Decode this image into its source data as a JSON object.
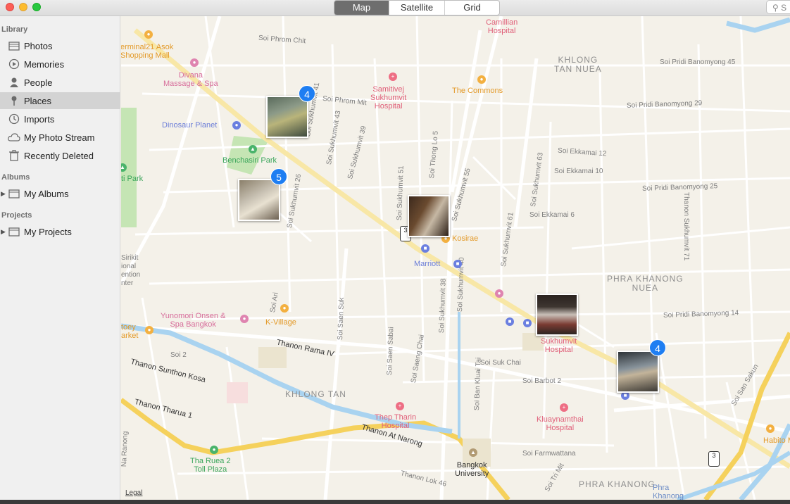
{
  "window": {
    "segments": [
      "Map",
      "Satellite",
      "Grid"
    ],
    "search_text": "S"
  },
  "sidebar": {
    "sections": {
      "library": "Library",
      "albums": "Albums",
      "projects": "Projects"
    },
    "library_items": [
      {
        "label": "Photos",
        "icon": "photos-icon"
      },
      {
        "label": "Memories",
        "icon": "memories-icon"
      },
      {
        "label": "People",
        "icon": "people-icon"
      },
      {
        "label": "Places",
        "icon": "places-pin-icon",
        "selected": true
      },
      {
        "label": "Imports",
        "icon": "imports-clock-icon"
      },
      {
        "label": "My Photo Stream",
        "icon": "cloud-icon"
      },
      {
        "label": "Recently Deleted",
        "icon": "trash-icon"
      }
    ],
    "albums_item": "My Albums",
    "projects_item": "My Projects"
  },
  "map": {
    "labels": {
      "terminal21": "erminal21 Asok\nShopping Mall",
      "soi_phrom_chit": "Soi Phrom Chit",
      "camillian": "Camillian\nHospital",
      "khlong_tan_nuea": "KHLONG\nTAN NUEA",
      "soi_pridi_45": "Soi Pridi Banomyong 45",
      "divana": "Divana\nMassage & Spa",
      "samitivej": "Samitivej\nSukhumvit\nHospital",
      "the_commons": "The Commons",
      "soi_phrom_mit": "Soi Phrom Mit",
      "soi_pridi_banomyong": "Soi Pridi Banomyong 29",
      "dinosaur_planet": "Dinosaur Planet",
      "soi_sukhumvit_41": "Soi Sukhumvit 41",
      "soi_sukhumvit_43": "Soi Sukhumvit 43",
      "soi_sukhumvit_39": "Soi Sukhumvit 39",
      "soi_thong_lo_5": "Soi Thong Lo 5",
      "soi_sukhumvit_55": "Soi Sukhumvit 55",
      "soi_sukhumvit_63": "Soi Sukhumvit 63",
      "soi_ekkamai_12": "Soi Ekkamai 12",
      "soi_ekkamai_10": "Soi Ekkamai 10",
      "soi_pridi_banomyong_25": "Soi Pridi Banomyong 25",
      "benchasiri": "Benchasiri Park",
      "ti_park": "ti Park",
      "soi_sukhumvit_26": "Soi Sukhumvit 26",
      "soi_sukhumvit_51": "Soi Sukhumvit 51",
      "soi_ekkamai_6": "Soi Ekkamai 6",
      "thanon_sukhumvit_71": "Thanon Sukhumvit 71",
      "soi_sukhumvit_61": "Soi Sukhumvit 61",
      "kosirae": "Kosirae",
      "marriott": "Marriott",
      "soi_sukhumvit_40": "Soi Sukhumvit 40",
      "sirikit": "Sirikit\nional\nention\nnter",
      "phra_khanong_nuea": "PHRA KHANONG\nNUEA",
      "soi_ari": "Soi Ari",
      "yunomori": "Yunomori Onsen &\nSpa Bangkok",
      "k_village": "K-Village",
      "soi_saen_suk": "Soi Saen Suk",
      "soi_sukhumvit_38": "Soi Sukhumvit 38",
      "toey_market": "toey\narket",
      "soi_pridi_14": "Soi Pridi Banomyong 14",
      "sukhumvit_hospital": "Sukhumvit\nHospital",
      "thanon_rama_iv": "Thanon Rama IV",
      "soi_2": "Soi 2",
      "soi_saen_sabai": "Soi Saen Sabai",
      "soi_saeng_chai": "Soi Saeng Chai",
      "soi_ban_kluai_tai": "Soi Ban Kluai Tai",
      "soi_suk_chai": "Soi Suk Chai",
      "soi_barbot_2": "Soi Barbot 2",
      "soi_san_sakun": "Soi San Sakun",
      "thanon_sunthon_kosa": "Thanon Sunthon Kosa",
      "khlong_tan": "KHLONG TAN",
      "thanon_tharua_1": "Thanon Tharua 1",
      "thep_tharin": "Thep Tharin\nHospital",
      "kluaynamthai": "Kluaynamthai\nHospital",
      "thanon_at_narong": "Thanon At Narong",
      "na_ranong": "Na Ranong",
      "tha_ruea_2": "Tha Ruea 2\nToll Plaza",
      "soi_farmwattana": "Soi Farmwattana",
      "bangkok_university": "Bangkok\nUniversity",
      "habito": "Habito Mal",
      "thanon_lok_46": "Thanon Lok 46",
      "soi_tri_mit": "Soi Tri Mit",
      "phra_khanong": "PHRA KHANONG",
      "phra_khanong_canal": "Phra\nKhanong",
      "shield_a": "3",
      "shield_b": "3"
    },
    "clusters": [
      {
        "count": "4"
      },
      {
        "count": "5"
      },
      {
        "count": ""
      },
      {
        "count": ""
      },
      {
        "count": "4"
      }
    ],
    "legal": "Legal"
  },
  "colors": {
    "badge": "#1e7ef2",
    "selected_row": "#d3d3d3",
    "main_road": "#f5d15c",
    "water": "#a9d3f0",
    "park": "#c5e5b4"
  }
}
